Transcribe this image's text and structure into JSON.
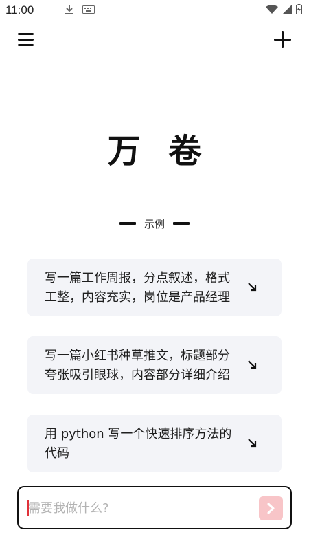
{
  "status_bar": {
    "time": "11:00",
    "icons_left": [
      "download-icon",
      "keyboard-icon"
    ],
    "icons_right": [
      "wifi-icon",
      "signal-icon",
      "battery-icon"
    ]
  },
  "top_bar": {
    "menu_icon": "hamburger-menu-icon",
    "new_icon": "plus-icon"
  },
  "app": {
    "title": "万 卷"
  },
  "examples": {
    "label": "示例",
    "items": [
      {
        "text": "写一篇工作周报，分点叙述，格式工整，内容充实，岗位是产品经理"
      },
      {
        "text": "写一篇小红书种草推文，标题部分夸张吸引眼球，内容部分详细介绍"
      },
      {
        "text": "用 python 写一个快速排序方法的代码"
      }
    ]
  },
  "input": {
    "placeholder": "需要我做什么?",
    "value": ""
  },
  "colors": {
    "card_bg": "#f3f4f8",
    "send_button_bg": "#f8c5c8",
    "caret": "#e0323a"
  }
}
